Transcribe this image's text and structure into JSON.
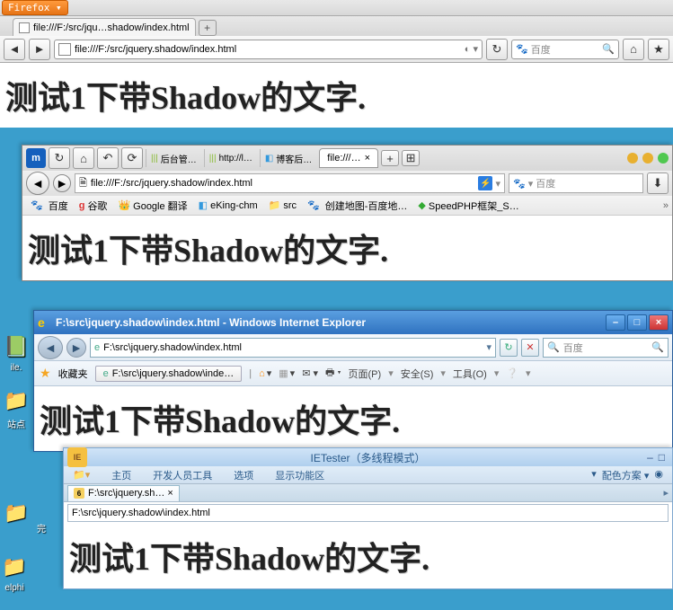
{
  "shadow_text": "测试1下带Shadow的文字.",
  "firefox": {
    "menu_label": "Firefox ▾",
    "tab_title": "file:///F:/src/jqu…shadow/index.html",
    "url": "file:///F:/src/jquery.shadow/index.html",
    "search_placeholder": "百度",
    "newtab": "+"
  },
  "maxthon": {
    "tabs": [
      "后台管…",
      "http://l…",
      "博客后…"
    ],
    "active_tab": "file:///…",
    "url": "file:///F:/src/jquery.shadow/index.html",
    "search_placeholder": "百度",
    "bookmarks": [
      "百度",
      "谷歌",
      "Google 翻译",
      "eKing-chm",
      "src",
      "创建地图-百度地…",
      "SpeedPHP框架_S…"
    ],
    "plus": "+",
    "grid": "⊞",
    "close_x": "×"
  },
  "ie": {
    "title": "F:\\src\\jquery.shadow\\index.html - Windows Internet Explorer",
    "url": "F:\\src\\jquery.shadow\\index.html",
    "search_placeholder": "百度",
    "fav_label": "收藏夹",
    "tab_label": "F:\\src\\jquery.shadow\\inde…",
    "menu": {
      "page": "页面(P)",
      "safety": "安全(S)",
      "tools": "工具(O)",
      "help": "❔"
    }
  },
  "ietester": {
    "title": "IETester（多线程模式）",
    "tabs": {
      "home": "主页",
      "dev": "开发人员工具",
      "opts": "选项",
      "display": "显示功能区"
    },
    "right_menu": "配色方案 ▾",
    "tab_label": "F:\\src\\jquery.sh… ×",
    "url": "F:\\src\\jquery.shadow\\index.html"
  },
  "desktop": {
    "file": "ile.",
    "site": "站点",
    "done": "完",
    "elphi": "elphi"
  },
  "glyphs": {
    "back": "◄",
    "fwd": "►",
    "reload": "↻",
    "stop": "✕",
    "home": "⌂",
    "down": "▾",
    "search": "🔍",
    "star": "★",
    "rss": "▤",
    "mail": "✉",
    "print": "🖶",
    "min": "–",
    "max": "□",
    "close": "×",
    "folder": "📁",
    "left": "◄",
    "right": "►"
  }
}
